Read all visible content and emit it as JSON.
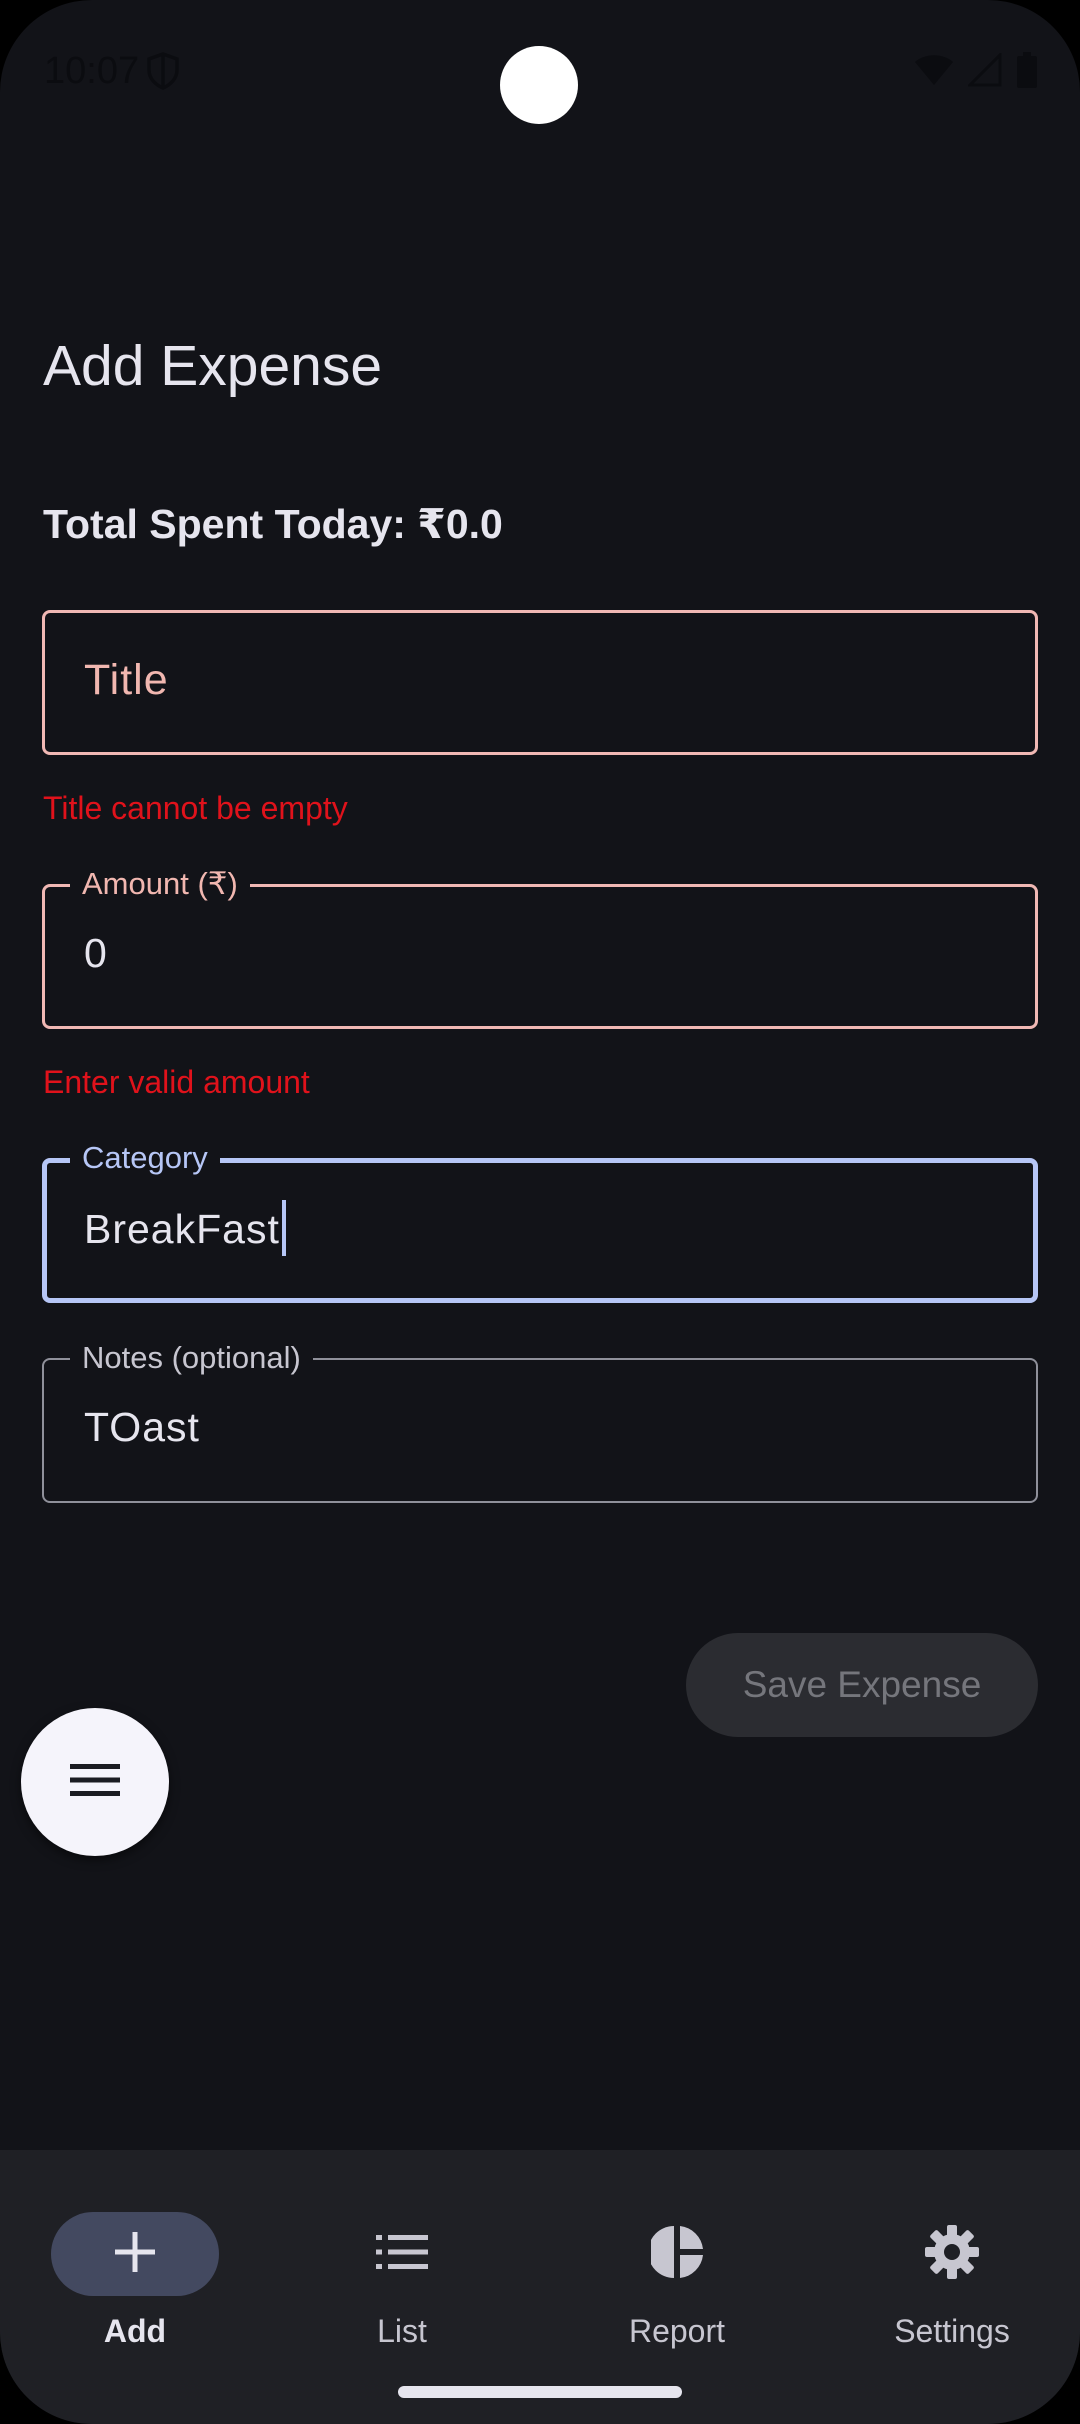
{
  "status_bar": {
    "time": "10:07"
  },
  "header": {
    "title": "Add Expense"
  },
  "summary": {
    "total_label": "Total Spent Today: ₹0.0"
  },
  "form": {
    "title": {
      "placeholder": "Title",
      "error": "Title cannot be empty"
    },
    "amount": {
      "label": "Amount (₹)",
      "value": "0",
      "error": "Enter valid amount"
    },
    "category": {
      "label": "Category",
      "value": "BreakFast"
    },
    "notes": {
      "label": "Notes (optional)",
      "value": "TOast"
    },
    "save_label": "Save Expense"
  },
  "nav": {
    "items": [
      {
        "label": "Add",
        "icon": "add-icon",
        "active": true
      },
      {
        "label": "List",
        "icon": "list-icon",
        "active": false
      },
      {
        "label": "Report",
        "icon": "pie-chart-icon",
        "active": false
      },
      {
        "label": "Settings",
        "icon": "gear-icon",
        "active": false
      }
    ]
  },
  "colors": {
    "background": "#121318",
    "error": "#e0121b",
    "error_outline": "#f0b8b4",
    "focus_outline": "#b6c6f6",
    "nav_active_pill": "#434960"
  }
}
